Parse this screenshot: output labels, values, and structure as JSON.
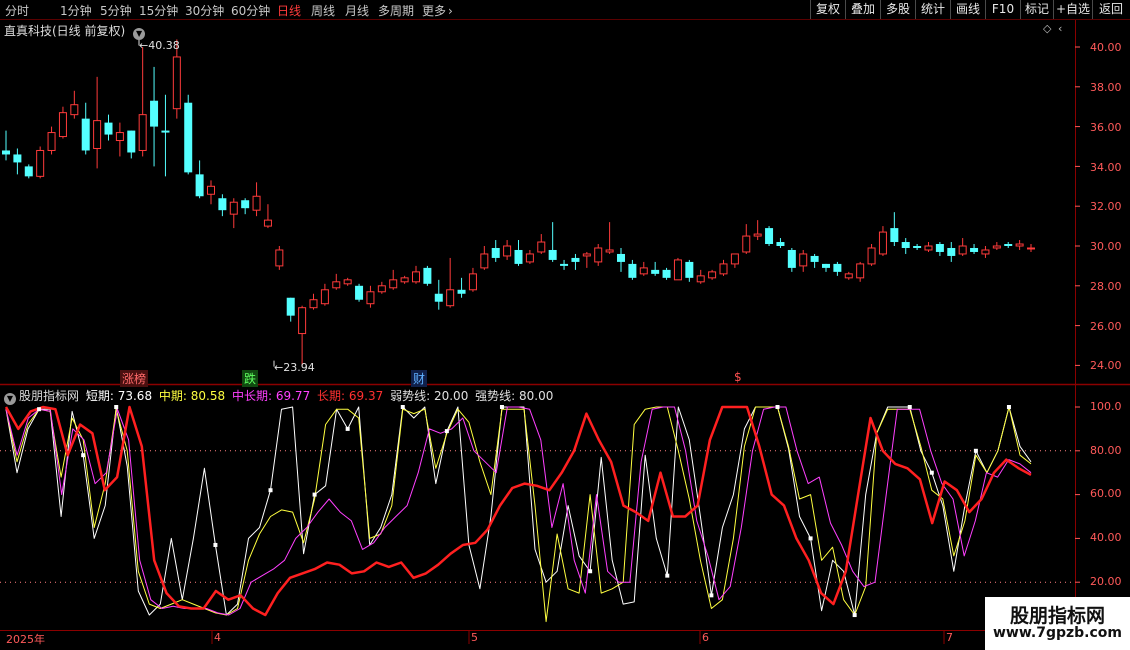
{
  "toolbar": {
    "periods": [
      "分时",
      "1分钟",
      "5分钟",
      "15分钟",
      "30分钟",
      "60分钟",
      "日线",
      "周线",
      "月线",
      "多周期",
      "更多"
    ],
    "active_period": "日线",
    "more_arrow": "›",
    "buttons": [
      "复权",
      "叠加",
      "多股",
      "统计",
      "画线",
      "F10",
      "标记",
      "+自选",
      "返回"
    ]
  },
  "main_chart": {
    "title": "直真科技(日线 前复权)",
    "high_label": "40.38",
    "low_label": "23.94",
    "y_ticks": [
      "40.00",
      "38.00",
      "36.00",
      "34.00",
      "32.00",
      "30.00",
      "28.00",
      "26.00",
      "24.00"
    ],
    "events": [
      "涨榜",
      "跌",
      "财",
      "$"
    ]
  },
  "indicator": {
    "name": "股朋指标网",
    "items": [
      {
        "label": "短期:",
        "value": "73.68",
        "color": "#ffffff"
      },
      {
        "label": "中期:",
        "value": "80.58",
        "color": "#ffff40"
      },
      {
        "label": "中长期:",
        "value": "69.77",
        "color": "#ff40ff"
      },
      {
        "label": "长期:",
        "value": "69.37",
        "color": "#ff3030"
      },
      {
        "label": "弱势线:",
        "value": "20.00",
        "color": "#e0e0e0"
      },
      {
        "label": "强势线:",
        "value": "80.00",
        "color": "#e0e0e0"
      }
    ],
    "y_ticks": [
      "100.0",
      "80.00",
      "60.00",
      "40.00",
      "20.00"
    ]
  },
  "time_axis": {
    "labels": [
      "2025年",
      "4",
      "5",
      "6",
      "7"
    ]
  },
  "watermark": {
    "line1": "股朋指标网",
    "line2": "www.7gpzb.com"
  },
  "colors": {
    "up": "#ff3b3b",
    "down": "#54ffff",
    "grid": "#8b0000",
    "short": "#ffffff",
    "mid": "#ffff40",
    "midlong": "#ff40ff",
    "long": "#ff2020"
  },
  "chart_data": [
    {
      "type": "candlestick",
      "title": "直真科技(日线 前复权)",
      "ylim": [
        23.5,
        41
      ],
      "candles": [
        [
          34.8,
          34.6,
          35.8,
          34.3
        ],
        [
          34.6,
          34.2,
          34.9,
          33.6
        ],
        [
          34.0,
          33.5,
          34.1,
          33.4
        ],
        [
          33.5,
          34.8,
          35.0,
          33.4
        ],
        [
          34.8,
          35.7,
          36.0,
          34.6
        ],
        [
          35.5,
          36.7,
          37.0,
          35.4
        ],
        [
          36.6,
          37.1,
          37.8,
          36.4
        ],
        [
          36.4,
          34.8,
          37.2,
          34.6
        ],
        [
          34.9,
          36.3,
          38.5,
          33.9
        ],
        [
          36.2,
          35.6,
          36.6,
          35.3
        ],
        [
          35.3,
          35.7,
          36.2,
          34.5
        ],
        [
          35.8,
          34.7,
          35.8,
          34.4
        ],
        [
          34.8,
          36.6,
          40.0,
          34.5
        ],
        [
          37.3,
          36.0,
          39.0,
          34.0
        ],
        [
          35.8,
          35.7,
          37.6,
          33.5
        ],
        [
          36.9,
          39.5,
          40.38,
          36.4
        ],
        [
          37.2,
          33.7,
          37.6,
          33.6
        ],
        [
          33.6,
          32.5,
          34.3,
          32.4
        ],
        [
          32.6,
          33.0,
          33.3,
          32.1
        ],
        [
          32.4,
          31.8,
          32.6,
          31.5
        ],
        [
          31.6,
          32.2,
          32.4,
          30.9
        ],
        [
          32.3,
          31.9,
          32.4,
          31.6
        ],
        [
          31.8,
          32.5,
          33.2,
          31.5
        ],
        [
          31.0,
          31.3,
          32.1,
          30.9
        ],
        [
          29.0,
          29.8,
          30.0,
          28.8
        ],
        [
          27.4,
          26.5,
          27.4,
          26.2
        ],
        [
          25.6,
          26.9,
          27.0,
          23.94
        ],
        [
          26.9,
          27.3,
          27.6,
          26.8
        ],
        [
          27.1,
          27.8,
          28.1,
          27.0
        ],
        [
          27.9,
          28.2,
          28.6,
          27.8
        ],
        [
          28.1,
          28.3,
          28.4,
          28.0
        ],
        [
          28.0,
          27.3,
          28.1,
          27.2
        ],
        [
          27.1,
          27.7,
          28.0,
          26.9
        ],
        [
          27.7,
          28.0,
          28.2,
          27.6
        ],
        [
          27.9,
          28.3,
          28.8,
          27.8
        ],
        [
          28.2,
          28.4,
          28.5,
          28.1
        ],
        [
          28.2,
          28.7,
          29.0,
          28.1
        ],
        [
          28.9,
          28.1,
          29.0,
          28.0
        ],
        [
          27.6,
          27.2,
          28.3,
          26.8
        ],
        [
          27.0,
          27.8,
          29.4,
          26.9
        ],
        [
          27.8,
          27.6,
          28.4,
          27.4
        ],
        [
          27.8,
          28.6,
          28.9,
          27.7
        ],
        [
          28.9,
          29.6,
          30.0,
          28.8
        ],
        [
          29.9,
          29.4,
          30.3,
          29.2
        ],
        [
          29.5,
          30.0,
          30.3,
          29.3
        ],
        [
          29.8,
          29.1,
          30.3,
          29.0
        ],
        [
          29.2,
          29.6,
          29.8,
          29.1
        ],
        [
          29.7,
          30.2,
          30.6,
          29.6
        ],
        [
          29.8,
          29.3,
          31.2,
          29.2
        ],
        [
          29.1,
          29.0,
          29.3,
          28.8
        ],
        [
          29.4,
          29.2,
          29.6,
          28.8
        ],
        [
          29.5,
          29.6,
          29.7,
          28.9
        ],
        [
          29.2,
          29.9,
          30.1,
          29.0
        ],
        [
          29.7,
          29.8,
          31.2,
          29.6
        ],
        [
          29.6,
          29.2,
          29.9,
          28.7
        ],
        [
          29.1,
          28.4,
          29.3,
          28.3
        ],
        [
          28.6,
          28.9,
          29.2,
          28.5
        ],
        [
          28.8,
          28.6,
          29.2,
          28.5
        ],
        [
          28.8,
          28.4,
          28.9,
          28.3
        ],
        [
          28.3,
          29.3,
          29.4,
          28.3
        ],
        [
          29.2,
          28.4,
          29.3,
          28.2
        ],
        [
          28.2,
          28.5,
          28.8,
          28.1
        ],
        [
          28.4,
          28.7,
          28.8,
          28.3
        ],
        [
          28.6,
          29.1,
          29.3,
          28.5
        ],
        [
          29.1,
          29.6,
          29.6,
          28.9
        ],
        [
          29.7,
          30.5,
          31.1,
          29.6
        ],
        [
          30.5,
          30.6,
          31.3,
          30.3
        ],
        [
          30.9,
          30.1,
          31.0,
          30.0
        ],
        [
          30.2,
          30.0,
          30.4,
          29.9
        ],
        [
          29.8,
          28.9,
          29.9,
          28.7
        ],
        [
          29.0,
          29.6,
          29.8,
          28.7
        ],
        [
          29.5,
          29.2,
          29.6,
          28.9
        ],
        [
          29.1,
          28.9,
          29.1,
          28.7
        ],
        [
          29.1,
          28.7,
          29.2,
          28.5
        ],
        [
          28.4,
          28.6,
          28.7,
          28.3
        ],
        [
          28.4,
          29.1,
          29.2,
          28.2
        ],
        [
          29.1,
          29.9,
          30.1,
          29.0
        ],
        [
          29.6,
          30.7,
          31.0,
          29.5
        ],
        [
          30.9,
          30.2,
          31.7,
          30.0
        ],
        [
          30.2,
          29.9,
          30.4,
          29.6
        ],
        [
          30.0,
          29.9,
          30.1,
          29.8
        ],
        [
          29.8,
          30.0,
          30.2,
          29.7
        ],
        [
          30.1,
          29.7,
          30.2,
          29.5
        ],
        [
          29.9,
          29.5,
          30.2,
          29.2
        ],
        [
          29.6,
          30.0,
          30.4,
          29.5
        ],
        [
          29.9,
          29.7,
          30.1,
          29.6
        ],
        [
          29.6,
          29.8,
          30.0,
          29.4
        ],
        [
          29.9,
          30.0,
          30.2,
          29.8
        ],
        [
          30.1,
          30.0,
          30.2,
          29.9
        ],
        [
          30.0,
          30.1,
          30.3,
          29.8
        ],
        [
          29.9,
          29.9,
          30.1,
          29.7
        ]
      ]
    },
    {
      "type": "line",
      "title": "股朋指标网",
      "ylim": [
        0,
        105
      ],
      "series": [
        {
          "name": "短期",
          "values": [
            99,
            70,
            90,
            99,
            99,
            50,
            98,
            78,
            40,
            55,
            100,
            73,
            16,
            5,
            10,
            40,
            12,
            40,
            72,
            37,
            5,
            10,
            40,
            45,
            62,
            99,
            100,
            33,
            60,
            64,
            99,
            90,
            100,
            37,
            45,
            60,
            100,
            95,
            100,
            65,
            89,
            100,
            37,
            17,
            50,
            100,
            100,
            100,
            35,
            20,
            25,
            55,
            32,
            25,
            77,
            30,
            10,
            11,
            78,
            40,
            23,
            100,
            85,
            50,
            14,
            45,
            60,
            90,
            100,
            100,
            100,
            81,
            50,
            40,
            7,
            30,
            25,
            5,
            60,
            88,
            100,
            100,
            100,
            80,
            70,
            55,
            25,
            55,
            80,
            70,
            80,
            100,
            82,
            75
          ]
        },
        {
          "name": "中期",
          "values": [
            99,
            75,
            92,
            99,
            98,
            68,
            95,
            85,
            45,
            65,
            99,
            80,
            25,
            10,
            8,
            10,
            12,
            10,
            8,
            6,
            5,
            8,
            30,
            42,
            50,
            53,
            52,
            38,
            58,
            92,
            99,
            99,
            95,
            40,
            42,
            55,
            99,
            97,
            99,
            72,
            88,
            99,
            93,
            75,
            60,
            99,
            99,
            99,
            55,
            2,
            42,
            17,
            15,
            60,
            15,
            17,
            20,
            92,
            99,
            100,
            100,
            80,
            58,
            30,
            8,
            12,
            40,
            82,
            100,
            100,
            100,
            82,
            58,
            60,
            30,
            36,
            12,
            5,
            18,
            88,
            99,
            99,
            99,
            82,
            62,
            58,
            32,
            48,
            78,
            70,
            80,
            100,
            78,
            74
          ]
        },
        {
          "name": "中长期",
          "values": [
            99,
            78,
            95,
            99,
            98,
            60,
            90,
            85,
            65,
            70,
            99,
            85,
            30,
            12,
            8,
            9,
            8,
            8,
            8,
            6,
            5,
            8,
            20,
            23,
            26,
            30,
            40,
            45,
            52,
            58,
            52,
            48,
            35,
            38,
            45,
            50,
            55,
            70,
            90,
            88,
            90,
            95,
            80,
            75,
            70,
            100,
            100,
            99,
            85,
            45,
            65,
            30,
            15,
            60,
            25,
            20,
            20,
            75,
            99,
            100,
            100,
            80,
            48,
            32,
            12,
            18,
            45,
            80,
            99,
            100,
            100,
            80,
            65,
            68,
            47,
            37,
            25,
            18,
            20,
            60,
            99,
            99,
            99,
            80,
            65,
            58,
            32,
            48,
            70,
            68,
            76,
            74,
            70
          ]
        },
        {
          "name": "长期",
          "values": [
            100,
            90,
            98,
            100,
            99,
            78,
            92,
            88,
            62,
            68,
            100,
            82,
            30,
            15,
            9,
            8,
            8,
            16,
            12,
            14,
            8,
            5,
            15,
            22,
            24,
            26,
            29,
            28,
            24,
            25,
            29,
            27,
            29,
            22,
            24,
            28,
            33,
            37,
            38,
            44,
            55,
            63,
            65,
            64,
            62,
            70,
            80,
            97,
            85,
            75,
            55,
            52,
            48,
            70,
            50,
            50,
            55,
            85,
            100,
            100,
            100,
            82,
            60,
            55,
            40,
            30,
            15,
            10,
            25,
            60,
            95,
            80,
            74,
            72,
            67,
            47,
            66,
            62,
            52,
            58,
            70,
            76,
            72,
            69
          ]
        },
        {
          "name": "弱势线",
          "values": [
            20
          ]
        },
        {
          "name": "强势线",
          "values": [
            80
          ]
        }
      ]
    }
  ]
}
